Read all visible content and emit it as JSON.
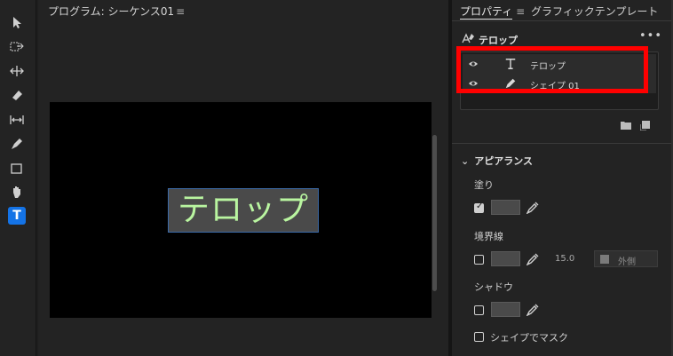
{
  "monitor": {
    "title": "プログラム: シーケンス01",
    "menu_icon": "≡"
  },
  "telop": {
    "text": "テロップ",
    "color": "#b9f5a0"
  },
  "toolbar": {
    "tools": [
      "selection-tool",
      "track-select-tool",
      "ripple-edit-tool",
      "razor-tool",
      "slip-tool",
      "pen-tool",
      "rectangle-tool",
      "hand-tool",
      "type-tool"
    ],
    "active_tool_glyph": "T"
  },
  "panel": {
    "tabs": [
      {
        "label": "プロパティ",
        "menu": "≡"
      },
      {
        "label": "グラフィックテンプレート"
      }
    ],
    "header": {
      "title": "テロップ",
      "more": "•••"
    },
    "layers": [
      {
        "name": "テロップ",
        "type": "text"
      },
      {
        "name": "シェイプ 01",
        "type": "shape"
      }
    ],
    "appearance": {
      "title": "アピアランス",
      "fill_label": "塗り",
      "fill_checked": true,
      "stroke_label": "境界線",
      "stroke_checked": false,
      "stroke_width": "15.0",
      "stroke_position": "外側",
      "shadow_label": "シャドウ",
      "shadow_checked": false,
      "mask_label": "シェイプでマスク",
      "mask_checked": false
    }
  },
  "colors": {
    "accent": "#1473e6",
    "highlight": "#ff0000",
    "bg": "#232323"
  }
}
